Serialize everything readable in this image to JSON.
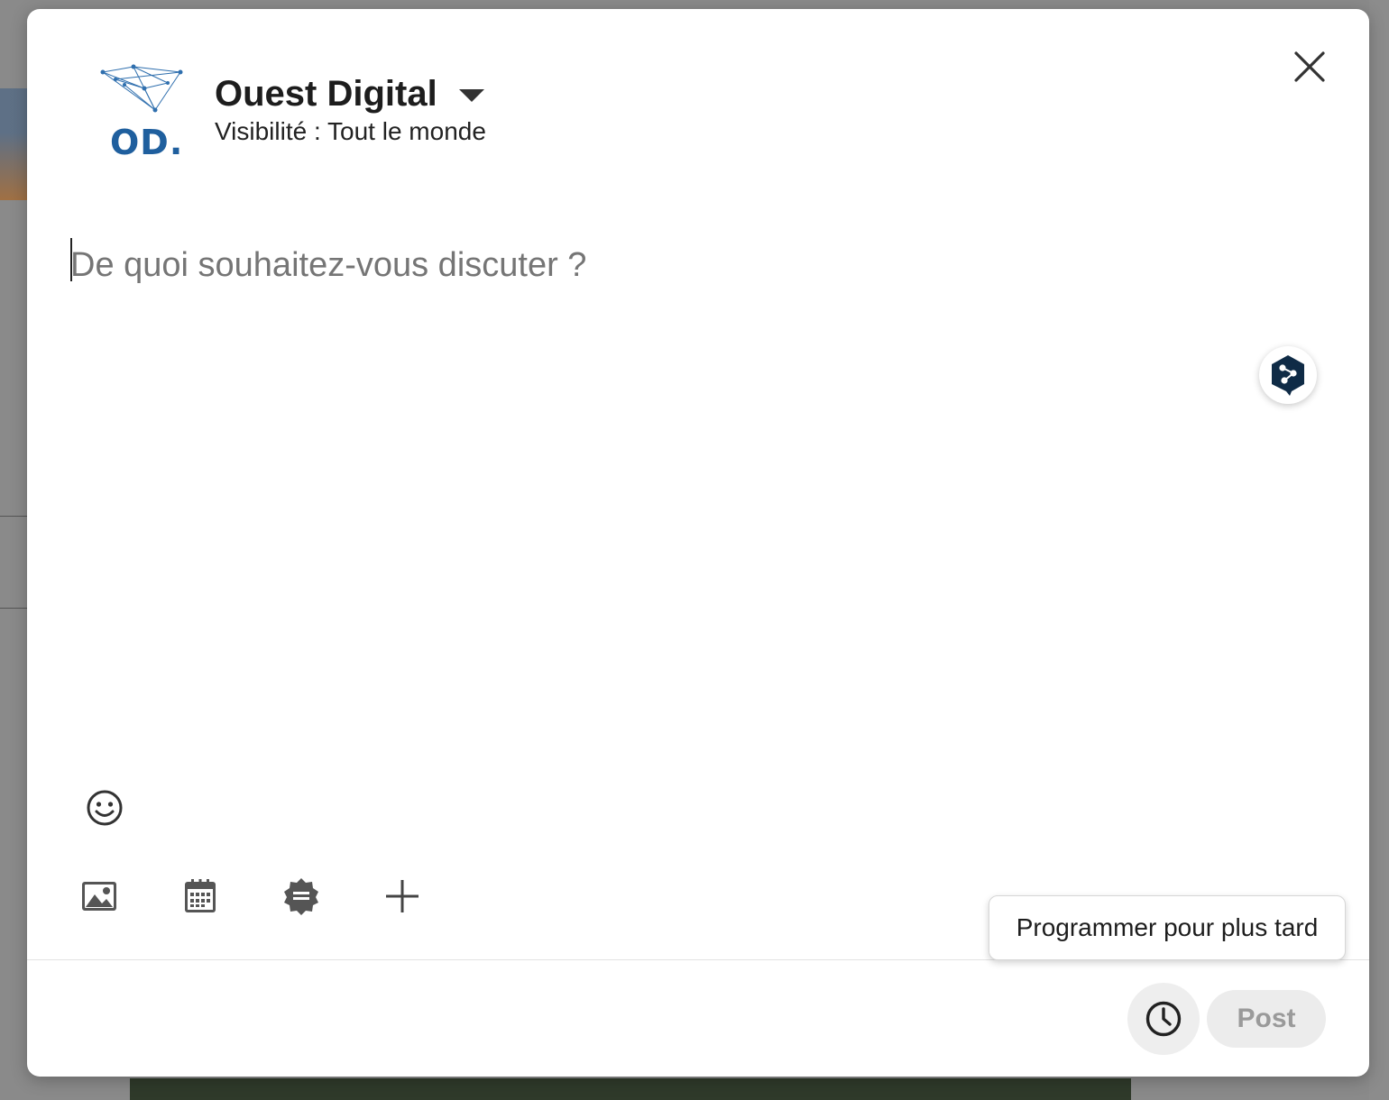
{
  "header": {
    "logo_text": "OD.",
    "company_name": "Ouest Digital",
    "visibility": "Visibilité : Tout le monde"
  },
  "editor": {
    "placeholder": "De quoi souhaitez-vous discuter ?"
  },
  "icons": {
    "close": "close-icon",
    "deepl": "deepl-icon",
    "emoji": "emoji-icon",
    "media": "image-icon",
    "event": "calendar-icon",
    "celebrate": "badge-icon",
    "more": "plus-icon",
    "schedule": "clock-icon"
  },
  "tooltip": {
    "schedule_text": "Programmer pour plus tard"
  },
  "footer": {
    "post_label": "Post"
  },
  "colors": {
    "brand_blue": "#1f5f9e",
    "deepl_navy": "#0f2b46",
    "disabled_text": "#9a9a9a"
  }
}
